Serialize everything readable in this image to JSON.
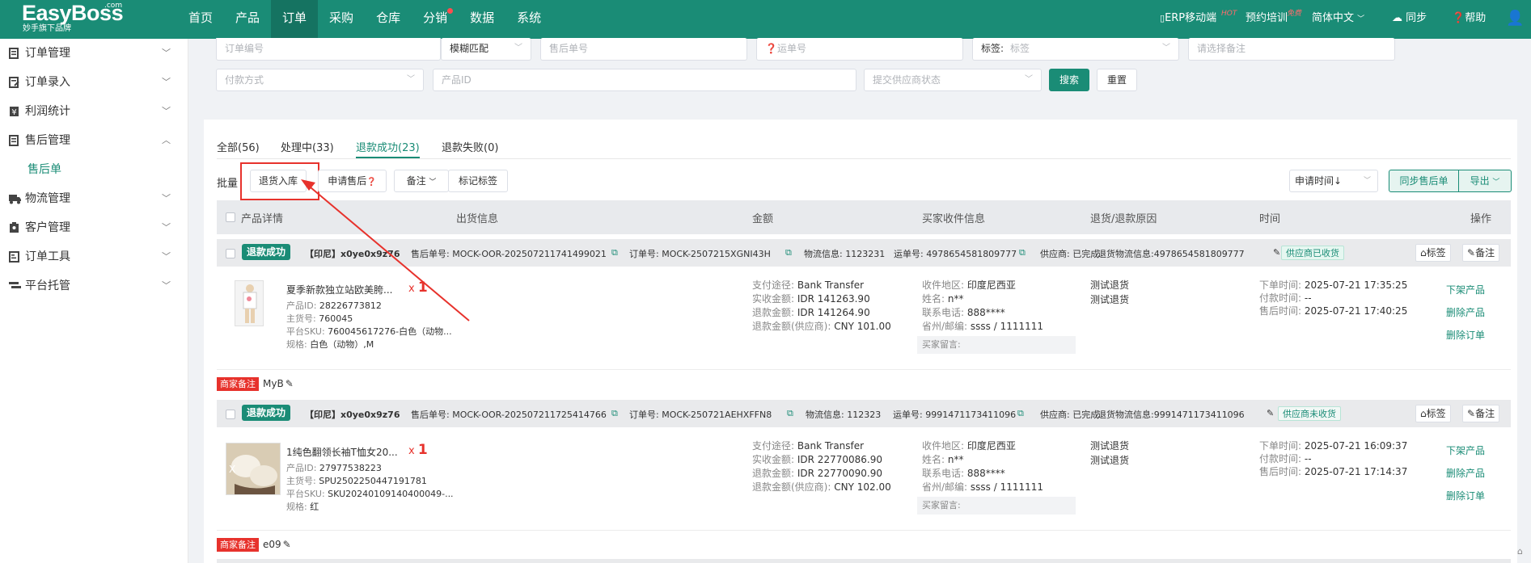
{
  "header": {
    "logo_title": "EasyBoss",
    "logo_com": ".com",
    "logo_sub": "妙手旗下品牌",
    "nav": [
      "首页",
      "产品",
      "订单",
      "采购",
      "仓库",
      "分销",
      "数据",
      "系统"
    ],
    "active_nav": "订单",
    "erp_mobile": "ERP移动端",
    "erp_badge": "HOT",
    "training": "预约培训",
    "training_badge": "免费",
    "language": "简体中文",
    "sync": "同步",
    "help": "帮助"
  },
  "sidebar": {
    "items": [
      {
        "label": "订单管理",
        "icon": "order-manage-icon"
      },
      {
        "label": "订单录入",
        "icon": "order-entry-icon"
      },
      {
        "label": "利润统计",
        "icon": "profit-icon"
      },
      {
        "label": "售后管理",
        "icon": "after-sales-icon"
      },
      {
        "label": "售后单",
        "icon": ""
      },
      {
        "label": "物流管理",
        "icon": "truck-icon"
      },
      {
        "label": "客户管理",
        "icon": "customer-icon"
      },
      {
        "label": "订单工具",
        "icon": "tools-icon"
      },
      {
        "label": "平台托管",
        "icon": "hosting-icon"
      }
    ]
  },
  "filters": {
    "order_no": "订单编号",
    "match_mode": "模糊匹配",
    "after_sale_no": "售后单号",
    "tracking_no": "运单号",
    "tag_label": "标签:",
    "tag_placeholder": "标签",
    "remark_placeholder": "请选择备注",
    "payment": "付款方式",
    "product_id": "产品ID",
    "supplier_status": "提交供应商状态",
    "search": "搜索",
    "reset": "重置"
  },
  "tabs": [
    "全部(56)",
    "处理中(33)",
    "退款成功(23)",
    "退款失败(0)"
  ],
  "batch": {
    "label": "批量",
    "return_stock": "退货入库",
    "apply_after_sale": "申请售后",
    "remark": "备注",
    "mark_tag": "标记标签",
    "sort": "申请时间",
    "sync_after_sale": "同步售后单",
    "export": "导出"
  },
  "table_headers": [
    "产品详情",
    "出货信息",
    "金额",
    "买家收件信息",
    "退货/退款原因",
    "时间",
    "操作"
  ],
  "orders": [
    {
      "status": "退款成功",
      "shop": "【印尼】x0ye0x9z76",
      "after_sale_no": "售后单号: MOCK-OOR-202507211741499021",
      "order_no": "订单号: MOCK-2507215XGNI43H",
      "logistics": "物流信息: 1123231",
      "waybill": "运单号: 4978654581809777",
      "supplier": "供应商: 已完成",
      "return_logistics": "退货物流信息:4978654581809777",
      "supplier_status": "供应商已收货",
      "tag_btn": "标签",
      "remark_btn": "备注",
      "title": "夏季新款独立站欧美胯...",
      "qty": "1",
      "product_id": "28226773812",
      "main_no": "760045",
      "sku": "760045617276-白色（动物...",
      "spec": "白色（动物）,M",
      "payment": "Bank Transfer",
      "paid": "IDR 141263.90",
      "refund": "IDR 141264.90",
      "refund_supplier": "CNY 101.00",
      "region": "印度尼西亚",
      "name": "n**",
      "phone": "888****",
      "province": "ssss / 1111111",
      "reason1": "测试退货",
      "reason2": "测试退货",
      "order_time": "2025-07-21 17:35:25",
      "pay_time": "--",
      "after_time": "2025-07-21 17:40:25",
      "note": "MyB"
    },
    {
      "status": "退款成功",
      "shop": "【印尼】x0ye0x9z76",
      "after_sale_no": "售后单号: MOCK-OOR-202507211725414766",
      "order_no": "订单号: MOCK-250721AEHXFFN8",
      "logistics": "物流信息: 112323",
      "waybill": "运单号: 9991471173411096",
      "supplier": "供应商: 已完成",
      "return_logistics": "退货物流信息:9991471173411096",
      "supplier_status": "供应商未收货",
      "tag_btn": "标签",
      "remark_btn": "备注",
      "title": "1纯色翻领长袖T恤女20...",
      "qty": "1",
      "product_id": "27977538223",
      "main_no": "SPU2502250447191781",
      "sku": "SKU20240109140400049-...",
      "spec": "红",
      "payment": "Bank Transfer",
      "paid": "IDR 22770086.90",
      "refund": "IDR 22770090.90",
      "refund_supplier": "CNY 102.00",
      "region": "印度尼西亚",
      "name": "n**",
      "phone": "888****",
      "province": "ssss / 1111111",
      "reason1": "测试退货",
      "reason2": "测试退货",
      "order_time": "2025-07-21 16:09:37",
      "pay_time": "--",
      "after_time": "2025-07-21 17:14:37",
      "note": "e09"
    }
  ],
  "labels": {
    "product_id": "产品ID:",
    "main_no": "主货号:",
    "sku": "平台SKU:",
    "spec": "规格:",
    "payment": "支付途径:",
    "paid": "实收金额:",
    "refund": "退款金额:",
    "refund_supplier": "退款金额(供应商):",
    "region": "收件地区:",
    "name": "姓名:",
    "phone": "联系电话:",
    "province": "省州/邮编:",
    "buyer_msg": "买家留言:",
    "order_time": "下单时间:",
    "pay_time": "付款时间:",
    "after_time": "售后时间:",
    "merchant_note": "商家备注",
    "qty_prefix": "x",
    "delist": "下架产品",
    "delete_product": "删除产品",
    "delete_order": "删除订单"
  },
  "colors": {
    "brand": "#1a8c76",
    "annotation": "#e7322c"
  }
}
